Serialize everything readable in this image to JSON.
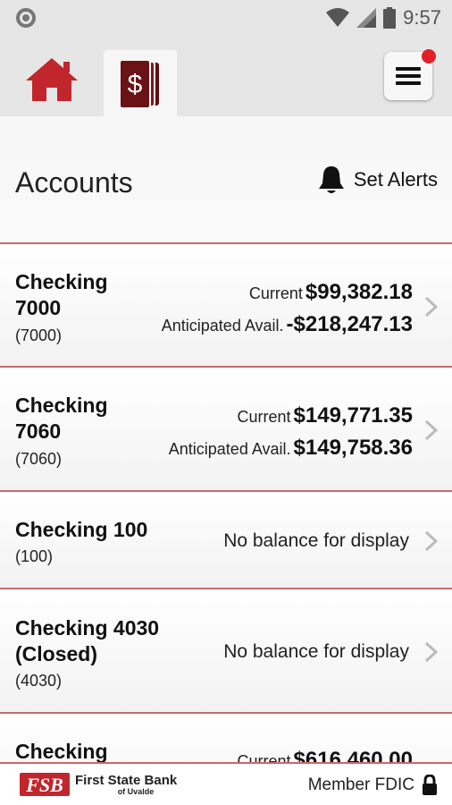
{
  "status_bar": {
    "time": "9:57"
  },
  "tabs": {
    "home_icon": "home-icon",
    "accounts_icon": "dollar-cards-icon",
    "menu_icon": "hamburger-icon"
  },
  "header": {
    "title": "Accounts",
    "alerts_label": "Set Alerts"
  },
  "accounts": [
    {
      "name_line1": "Checking",
      "name_line2": "7000",
      "number": "(7000)",
      "current_label": "Current",
      "current": "$99,382.18",
      "anticipated_label": "Anticipated Avail.",
      "anticipated": "-$218,247.13"
    },
    {
      "name_line1": "Checking",
      "name_line2": "7060",
      "number": "(7060)",
      "current_label": "Current",
      "current": "$149,771.35",
      "anticipated_label": "Anticipated Avail.",
      "anticipated": "$149,758.36"
    },
    {
      "name_line1": "Checking 100",
      "number": "(100)",
      "no_balance": "No balance for display"
    },
    {
      "name_line1": "Checking 4030",
      "name_line2": "(Closed)",
      "number": "(4030)",
      "no_balance": "No balance for display"
    },
    {
      "name_line1": "Checking",
      "current_label": "Current",
      "current": "$616,460.00"
    }
  ],
  "footer": {
    "bank_name": "First State Bank",
    "bank_sub": "of Uvalde",
    "fdic": "Member FDIC"
  },
  "colors": {
    "brand_red": "#c0262b",
    "accent_maroon": "#6b1216",
    "divider": "#c9696b"
  }
}
